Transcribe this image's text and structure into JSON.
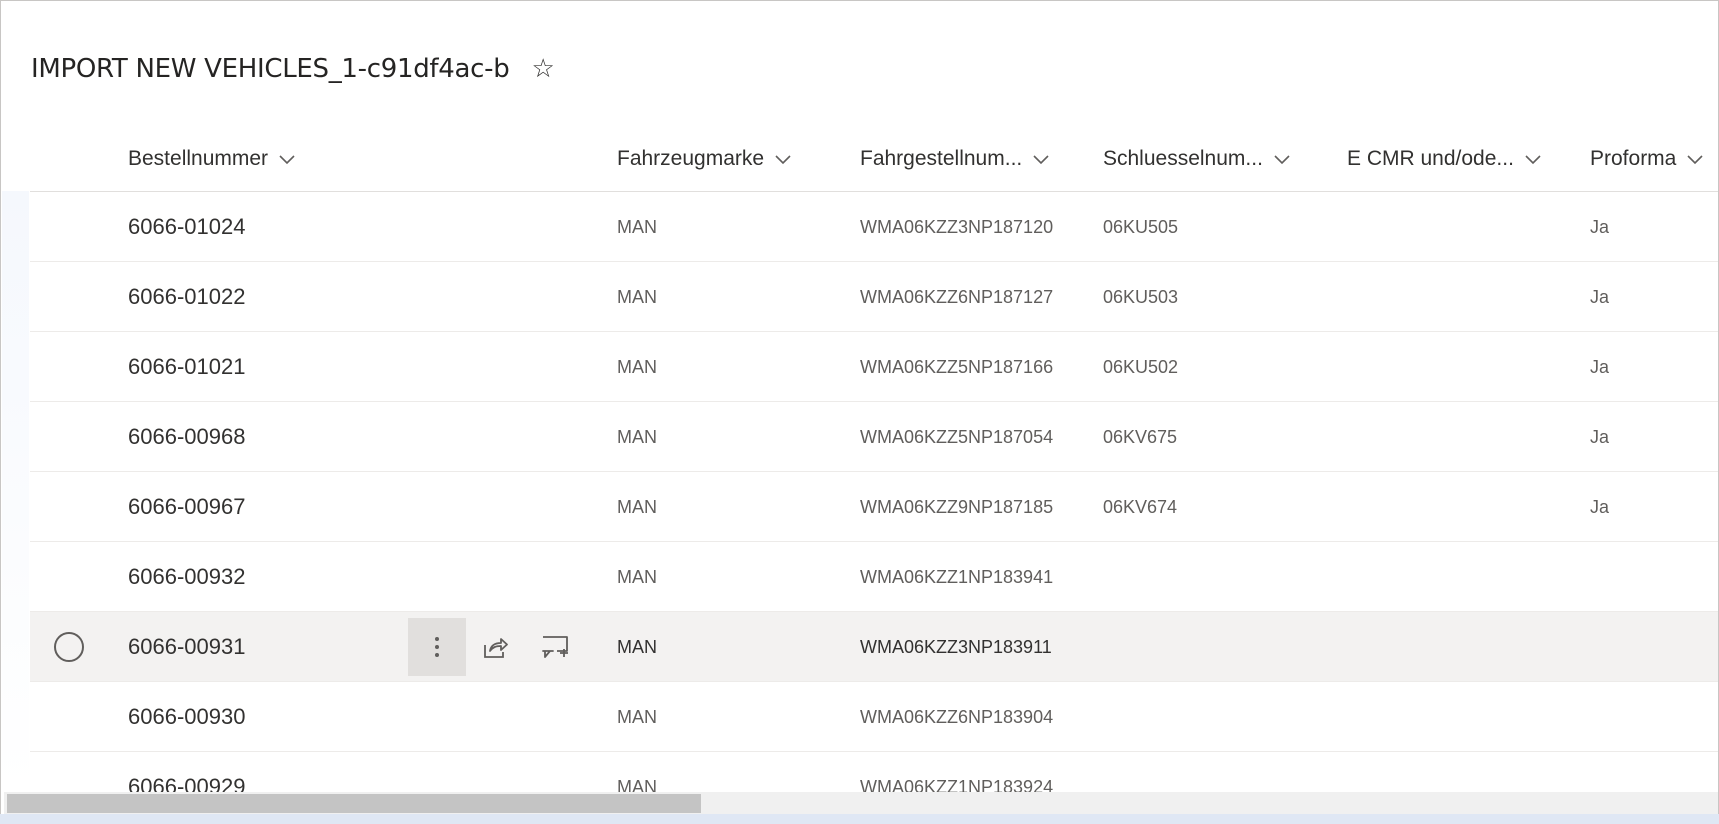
{
  "page": {
    "title": "IMPORT NEW VEHICLES_1-c91df4ac-b",
    "favorite_icon": "star-outline-icon"
  },
  "columns": [
    {
      "label": "Bestellnummer"
    },
    {
      "label": "Fahrzeugmarke"
    },
    {
      "label": "Fahrgestellnum..."
    },
    {
      "label": "Schluesselnum..."
    },
    {
      "label": "E CMR und/ode..."
    },
    {
      "label": "Proforma"
    }
  ],
  "rows": [
    {
      "order": "6066-01024",
      "brand": "MAN",
      "vin": "WMA06KZZ3NP187120",
      "key": "06KU505",
      "ecmr": "",
      "proforma": "Ja"
    },
    {
      "order": "6066-01022",
      "brand": "MAN",
      "vin": "WMA06KZZ6NP187127",
      "key": "06KU503",
      "ecmr": "",
      "proforma": "Ja"
    },
    {
      "order": "6066-01021",
      "brand": "MAN",
      "vin": "WMA06KZZ5NP187166",
      "key": "06KU502",
      "ecmr": "",
      "proforma": "Ja"
    },
    {
      "order": "6066-00968",
      "brand": "MAN",
      "vin": "WMA06KZZ5NP187054",
      "key": "06KV675",
      "ecmr": "",
      "proforma": "Ja"
    },
    {
      "order": "6066-00967",
      "brand": "MAN",
      "vin": "WMA06KZZ9NP187185",
      "key": "06KV674",
      "ecmr": "",
      "proforma": "Ja"
    },
    {
      "order": "6066-00932",
      "brand": "MAN",
      "vin": "WMA06KZZ1NP183941",
      "key": "",
      "ecmr": "",
      "proforma": ""
    },
    {
      "order": "6066-00931",
      "brand": "MAN",
      "vin": "WMA06KZZ3NP183911",
      "key": "",
      "ecmr": "",
      "proforma": ""
    },
    {
      "order": "6066-00930",
      "brand": "MAN",
      "vin": "WMA06KZZ6NP183904",
      "key": "",
      "ecmr": "",
      "proforma": ""
    },
    {
      "order": "6066-00929",
      "brand": "MAN",
      "vin": "WMA06KZZ1NP183924",
      "key": "",
      "ecmr": "",
      "proforma": ""
    }
  ],
  "hovered_row_actions": {
    "more_icon": "more-vertical-icon",
    "share_icon": "share-icon",
    "comment_icon": "add-comment-icon"
  },
  "colors": {
    "hover_row": "#f3f2f1",
    "text_primary": "#323130",
    "text_secondary": "#605e5c"
  }
}
